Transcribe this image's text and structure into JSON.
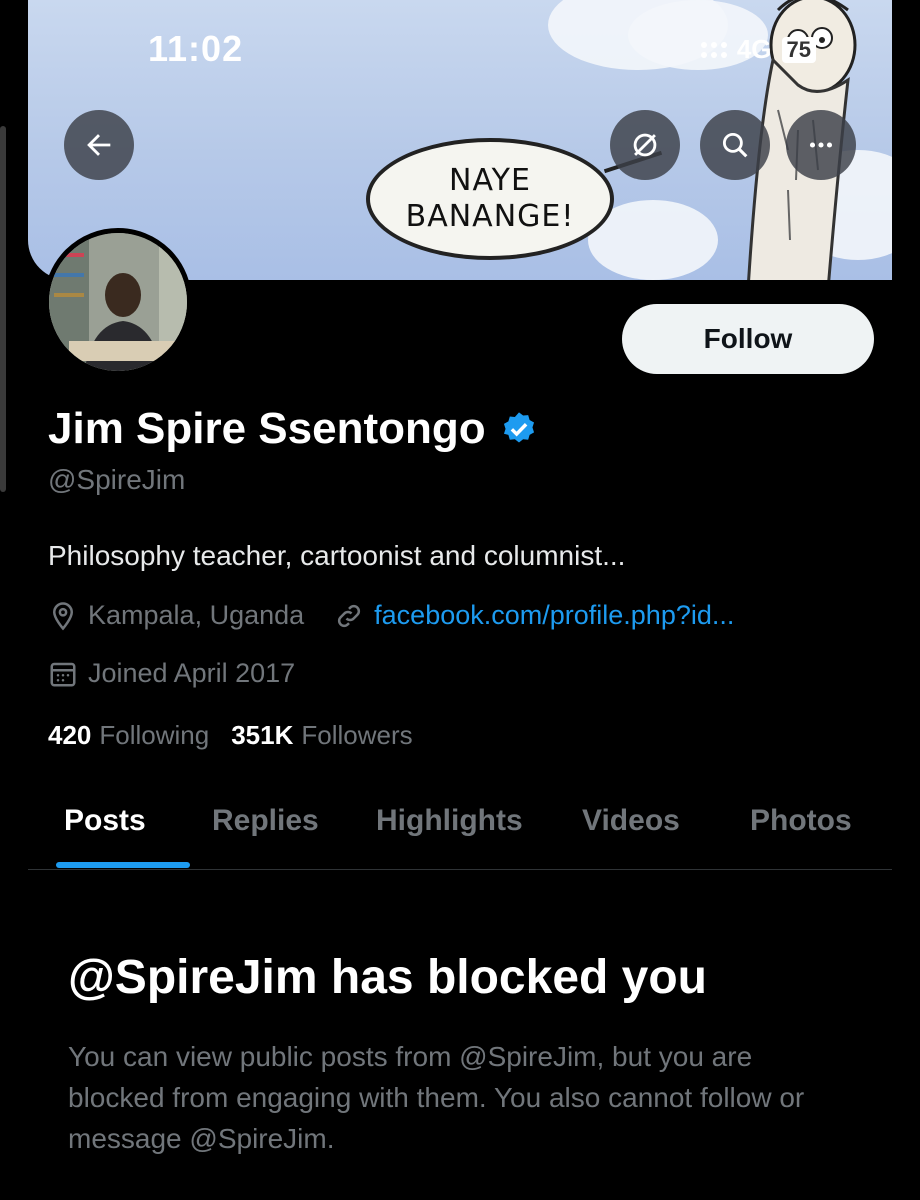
{
  "status_bar": {
    "time": "11:02",
    "network": "4G",
    "battery": "75"
  },
  "header": {
    "back_icon": "arrow-left-icon",
    "actions": [
      {
        "name": "mute-icon"
      },
      {
        "name": "search-icon"
      },
      {
        "name": "more-icon"
      }
    ],
    "banner_text_line1": "NAYE",
    "banner_text_line2": "BANANGE!"
  },
  "profile": {
    "name": "Jim Spire Ssentongo",
    "handle": "@SpireJim",
    "bio": "Philosophy teacher, cartoonist and columnist...",
    "location": "Kampala, Uganda",
    "website": "facebook.com/profile.php?id...",
    "joined": "Joined April 2017",
    "following_count": "420",
    "following_label": "Following",
    "followers_count": "351K",
    "followers_label": "Followers",
    "follow_button": "Follow",
    "verified_color": "#1d9bf0"
  },
  "tabs": [
    {
      "label": "Posts",
      "active": true
    },
    {
      "label": "Replies",
      "active": false
    },
    {
      "label": "Highlights",
      "active": false
    },
    {
      "label": "Videos",
      "active": false
    },
    {
      "label": "Photos",
      "active": false
    }
  ],
  "blocked": {
    "title": "@SpireJim has blocked you",
    "message": "You can view public posts from @SpireJim, but you are blocked from engaging with them. You also cannot follow or message @SpireJim."
  }
}
